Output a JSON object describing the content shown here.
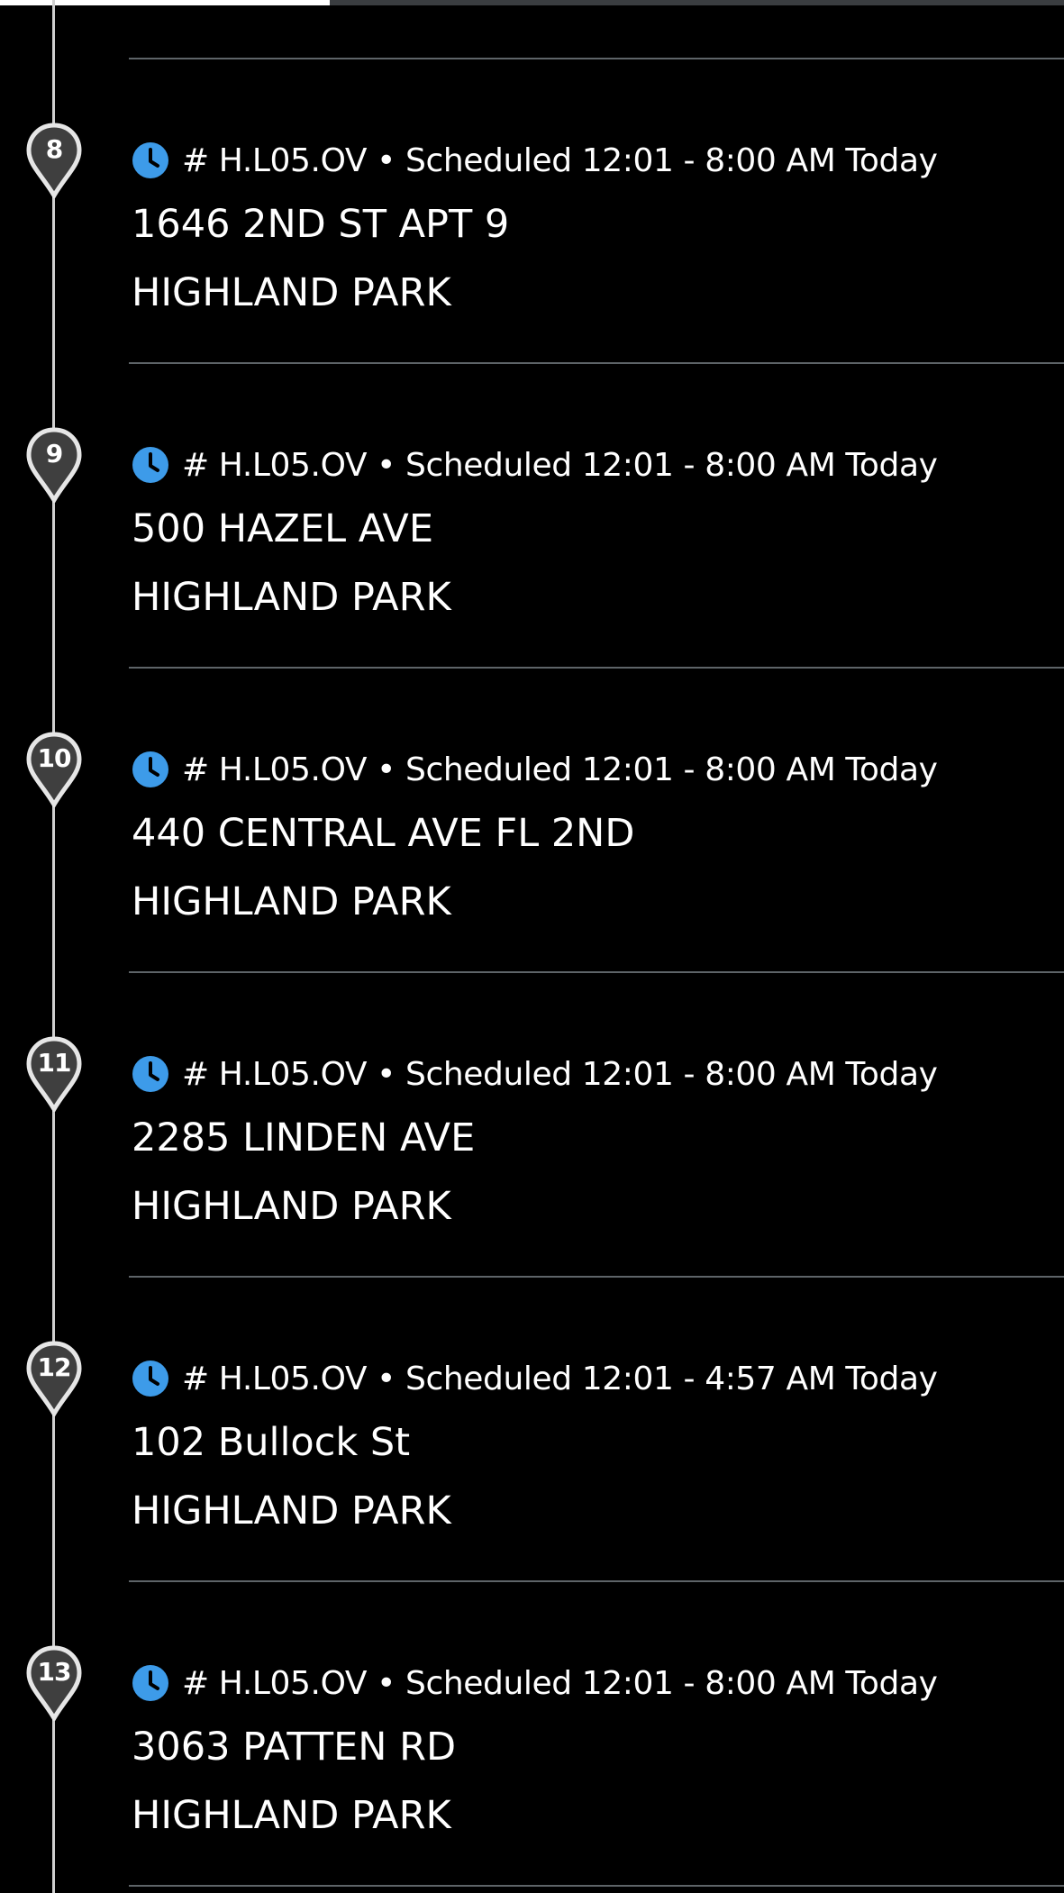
{
  "progress": {
    "fraction": 0.31
  },
  "colors": {
    "background": "#000000",
    "text": "#ffffff",
    "clock_accent": "#3d9be9",
    "pin_fill": "#3f3f3f",
    "pin_stroke": "#e6e6e6",
    "divider": "#5e6468"
  },
  "stops": [
    {
      "number": "8",
      "meta": "# H.L05.OV • Scheduled 12:01 - 8:00 AM Today",
      "address_line1": "1646 2ND ST APT 9",
      "address_line2": "HIGHLAND PARK",
      "icon": "clock-icon"
    },
    {
      "number": "9",
      "meta": "# H.L05.OV • Scheduled 12:01 - 8:00 AM Today",
      "address_line1": "500 HAZEL AVE",
      "address_line2": "HIGHLAND PARK",
      "icon": "clock-icon"
    },
    {
      "number": "10",
      "meta": "# H.L05.OV • Scheduled 12:01 - 8:00 AM Today",
      "address_line1": "440 CENTRAL AVE FL 2ND",
      "address_line2": "HIGHLAND PARK",
      "icon": "clock-icon"
    },
    {
      "number": "11",
      "meta": "# H.L05.OV • Scheduled 12:01 - 8:00 AM Today",
      "address_line1": "2285 LINDEN AVE",
      "address_line2": "HIGHLAND PARK",
      "icon": "clock-icon"
    },
    {
      "number": "12",
      "meta": "# H.L05.OV • Scheduled 12:01 - 4:57 AM Today",
      "address_line1": "102 Bullock St",
      "address_line2": "HIGHLAND PARK",
      "icon": "clock-icon"
    },
    {
      "number": "13",
      "meta": "# H.L05.OV • Scheduled 12:01 - 8:00 AM Today",
      "address_line1": "3063 PATTEN RD",
      "address_line2": "HIGHLAND PARK",
      "icon": "clock-icon"
    }
  ]
}
